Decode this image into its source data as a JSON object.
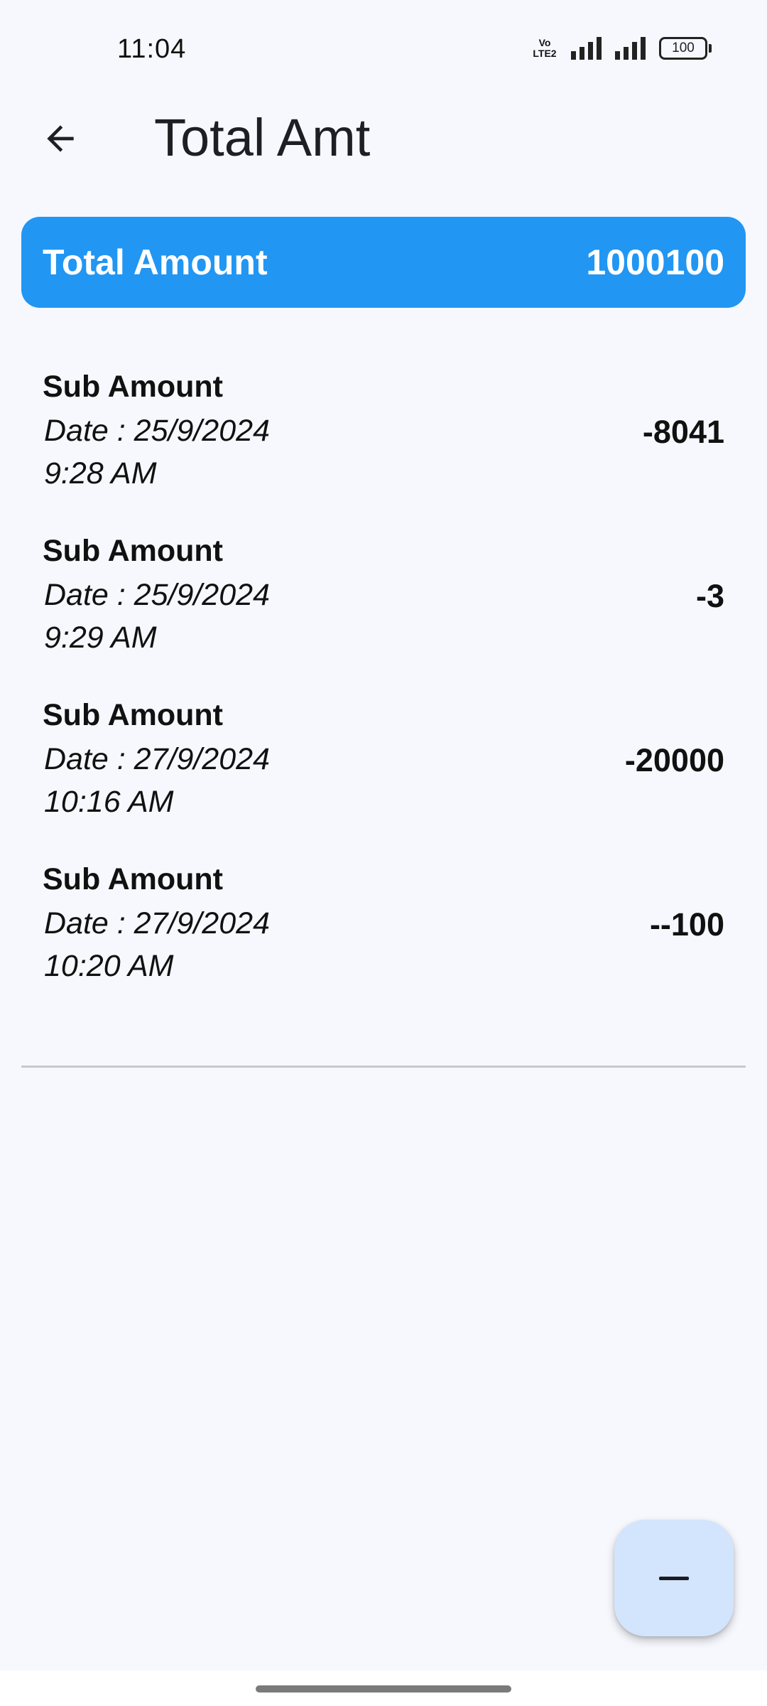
{
  "status_bar": {
    "time": "11:04",
    "network_label_line1": "Vo",
    "network_label_line2": "LTE2",
    "battery": "100"
  },
  "app_bar": {
    "title": "Total Amt",
    "back_icon": "arrow-left-icon"
  },
  "total_card": {
    "label": "Total Amount",
    "value": "1000100",
    "color": "#2196f3"
  },
  "entries": [
    {
      "title": "Sub Amount",
      "date": "Date : 25/9/2024",
      "time": "9:28 AM",
      "amount": "-8041"
    },
    {
      "title": "Sub Amount",
      "date": "Date : 25/9/2024",
      "time": "9:29 AM",
      "amount": "-3"
    },
    {
      "title": "Sub Amount",
      "date": "Date : 27/9/2024",
      "time": "10:16 AM",
      "amount": "-20000"
    },
    {
      "title": "Sub Amount",
      "date": "Date : 27/9/2024",
      "time": "10:20 AM",
      "amount": "--100"
    }
  ],
  "fab": {
    "icon": "minus-icon",
    "color": "#d3e4fd"
  }
}
